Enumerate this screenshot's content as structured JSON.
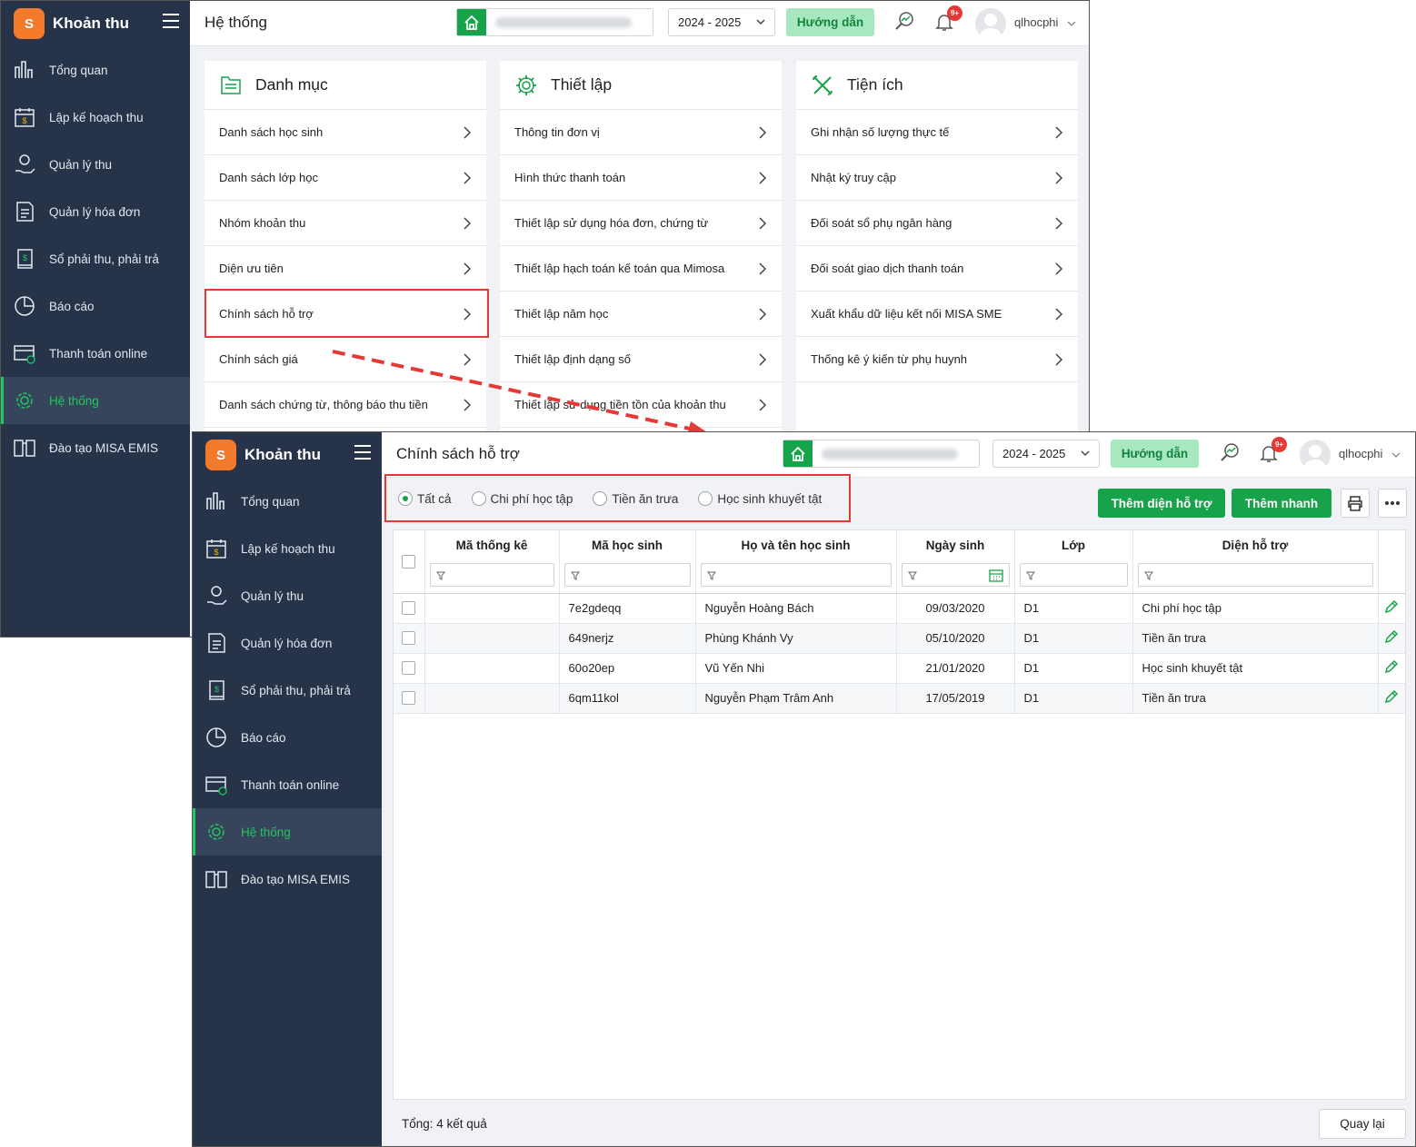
{
  "colors": {
    "sidebar": "#263349",
    "accent": "#17a34a",
    "active_text": "#22c55e",
    "highlight_box": "#e53935"
  },
  "app": {
    "name": "Khoản thu"
  },
  "nav": [
    {
      "label": "Tổng quan",
      "icon": "bar-chart-icon"
    },
    {
      "label": "Lập kế hoạch thu",
      "icon": "calendar-money-icon"
    },
    {
      "label": "Quản lý thu",
      "icon": "hand-coin-icon"
    },
    {
      "label": "Quản lý hóa đơn",
      "icon": "invoice-icon"
    },
    {
      "label": "Sổ phải thu, phải trả",
      "icon": "ledger-icon"
    },
    {
      "label": "Báo cáo",
      "icon": "pie-chart-icon"
    },
    {
      "label": "Thanh toán online",
      "icon": "online-payment-icon"
    },
    {
      "label": "Hệ thống",
      "icon": "gear-icon",
      "active": true
    },
    {
      "label": "Đào tạo MISA EMIS",
      "icon": "book-icon"
    }
  ],
  "header": {
    "year": "2024 - 2025",
    "guide": "Hướng dẫn",
    "badge": "9+",
    "user": "qlhocphi"
  },
  "screen1": {
    "title": "Hệ thống",
    "cards": [
      {
        "title": "Danh mục",
        "icon": "document-list-icon",
        "items": [
          "Danh sách học sinh",
          "Danh sách lớp học",
          "Nhóm khoản thu",
          "Diện ưu tiên",
          "Chính sách hỗ trợ",
          "Chính sách giá",
          "Danh sách chứng từ, thông báo thu tiền"
        ]
      },
      {
        "title": "Thiết lập",
        "icon": "gear-icon",
        "items": [
          "Thông tin đơn vị",
          "Hình thức thanh toán",
          "Thiết lập sử dụng hóa đơn, chứng từ",
          "Thiết lập hạch toán kế toán qua Mimosa",
          "Thiết lập năm học",
          "Thiết lập định dạng số",
          "Thiết lập sử dụng tiền tồn của khoản thu"
        ]
      },
      {
        "title": "Tiện ích",
        "icon": "tools-icon",
        "items": [
          "Ghi nhận số lượng thực tế",
          "Nhật ký truy cập",
          "Đối soát sổ phụ ngân hàng",
          "Đối soát giao dịch thanh toán",
          "Xuất khẩu dữ liệu kết nối MISA SME",
          "Thống kê ý kiến từ phụ huynh"
        ]
      }
    ]
  },
  "screen2": {
    "title": "Chính sách hỗ trợ",
    "filters": [
      {
        "label": "Tất cả",
        "checked": true
      },
      {
        "label": "Chi phí học tập",
        "checked": false
      },
      {
        "label": "Tiền ăn trưa",
        "checked": false
      },
      {
        "label": "Học sinh khuyết tật",
        "checked": false
      }
    ],
    "add_button": "Thêm diện hỗ trợ",
    "quick_add_button": "Thêm nhanh",
    "columns": [
      "Mã thống kê",
      "Mã học sinh",
      "Họ và tên học sinh",
      "Ngày sinh",
      "Lớp",
      "Diện hỗ trợ"
    ],
    "rows": [
      {
        "code": "",
        "student_id": "7e2gdeqq",
        "name": "Nguyễn Hoàng Bách",
        "dob": "09/03/2020",
        "class": "D1",
        "support": "Chi phí học tập"
      },
      {
        "code": "",
        "student_id": "649nerjz",
        "name": "Phùng Khánh Vy",
        "dob": "05/10/2020",
        "class": "D1",
        "support": "Tiền ăn trưa"
      },
      {
        "code": "",
        "student_id": "60o20ep",
        "name": "Vũ Yến Nhi",
        "dob": "21/01/2020",
        "class": "D1",
        "support": "Học sinh khuyết tật"
      },
      {
        "code": "",
        "student_id": "6qm11kol",
        "name": "Nguyễn Phạm Trâm Anh",
        "dob": "17/05/2019",
        "class": "D1",
        "support": "Tiền ăn trưa"
      }
    ],
    "total": "Tổng: 4 kết quả",
    "back": "Quay lại"
  }
}
